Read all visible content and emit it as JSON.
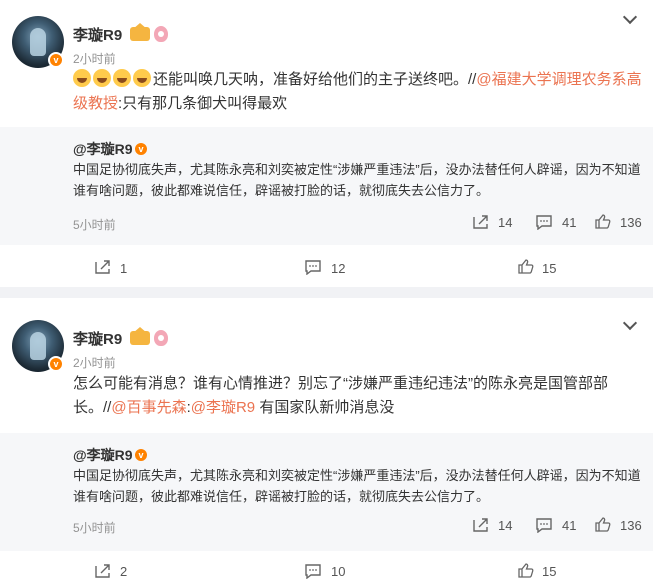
{
  "posts": [
    {
      "user": "李璇R9",
      "time": "2小时前",
      "text_parts": {
        "a": "还能叫唤几天呐，准备好给他们的主子送终吧。//",
        "link": "@福建大学调理农务系高级教授",
        "b": ":只有那几条御犬叫得最欢"
      },
      "repost": {
        "user": "@李璇R9",
        "text": "中国足协彻底失声，尤其陈永亮和刘奕被定性“涉嫌严重违法”后，没办法替任何人辟谣，因为不知道谁有啥问题，彼此都难说信任，辟谣被打脸的话，就彻底失去公信力了。",
        "time": "5小时前",
        "shares": "14",
        "comments": "41",
        "likes": "136"
      },
      "actions": {
        "share": "1",
        "comment": "12",
        "like": "15"
      }
    },
    {
      "user": "李璇R9",
      "time": "2小时前",
      "text_parts": {
        "a": "怎么可能有消息？谁有心情推进？别忘了“涉嫌严重违纪违法”的陈永亮是国管部部长。//",
        "link1": "@百事先森",
        "colon": ":",
        "link2": "@李璇R9",
        "b": " 有国家队新帅消息没"
      },
      "repost": {
        "user": "@李璇R9",
        "text": "中国足协彻底失声，尤其陈永亮和刘奕被定性“涉嫌严重违法”后，没办法替任何人辟谣，因为不知道谁有啥问题，彼此都难说信任，辟谣被打脸的话，就彻底失去公信力了。",
        "time": "5小时前",
        "shares": "14",
        "comments": "41",
        "likes": "136"
      },
      "actions": {
        "share": "2",
        "comment": "10",
        "like": "15"
      }
    }
  ],
  "icons": {
    "more": "chevron-down-icon",
    "share": "share-icon",
    "comment": "comment-icon",
    "like": "thumbs-up-icon",
    "verified": "verified-badge-icon"
  },
  "colors": {
    "link": "#eb7350",
    "verified": "#ff8200"
  }
}
